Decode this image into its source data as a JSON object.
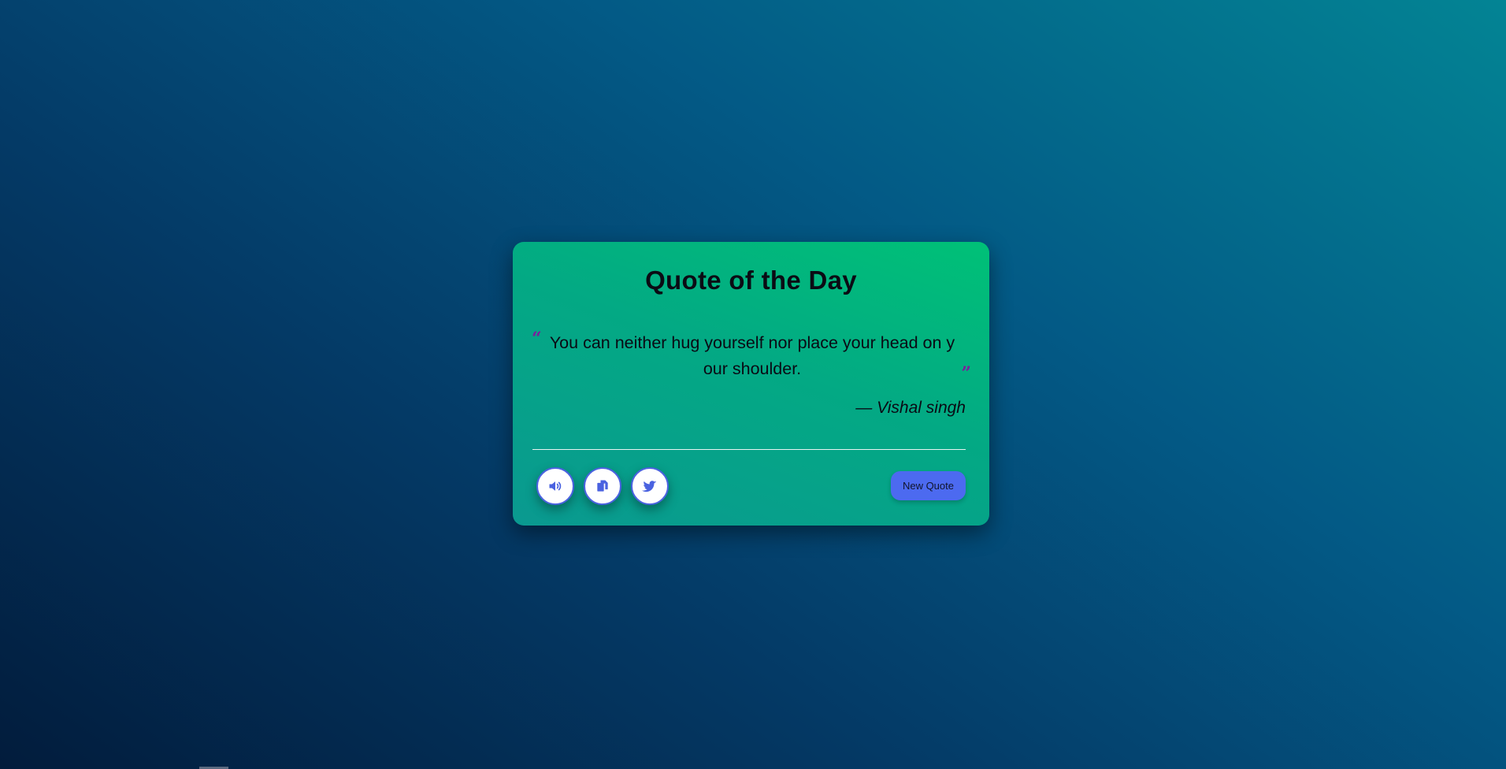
{
  "card": {
    "title": "Quote of the Day",
    "quote_open_mark": "“",
    "quote_text": "You can neither hug yourself nor place your head on your shoulder.",
    "quote_close_mark": "”",
    "author": "— Vishal singh"
  },
  "actions": {
    "sound_icon": "speaker-icon",
    "copy_icon": "copy-icon",
    "twitter_icon": "twitter-icon",
    "new_quote_label": "New Quote"
  },
  "colors": {
    "accent": "#4c6af0",
    "quote_mark": "#7b1f9c",
    "card_gradient_start": "#00c177",
    "card_gradient_end": "#0a9990"
  }
}
